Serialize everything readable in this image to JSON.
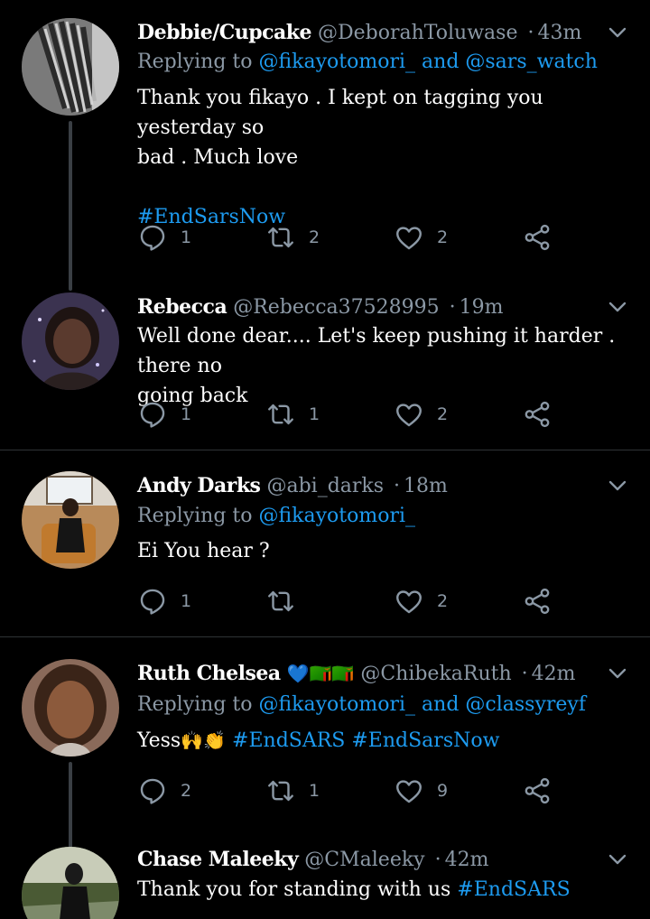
{
  "tweets": [
    {
      "name": "Debbie/Cupcake",
      "handle": "@DeborahToluwase",
      "time": "43m",
      "replying_prefix": "Replying to ",
      "replying_to": "@fikayotomori_ and @sars_watch",
      "text_lines": [
        "Thank you fikayo . I kept on tagging you yesterday so",
        "bad . Much love"
      ],
      "hashtag": "#EndSarsNow",
      "replies": "1",
      "retweets": "2",
      "likes": "2"
    },
    {
      "name": "Rebecca",
      "handle": "@Rebecca37528995",
      "time": "19m",
      "text_lines": [
        "Well done dear.... Let's keep pushing it harder . there no",
        "going back"
      ],
      "replies": "1",
      "retweets": "1",
      "likes": "2"
    },
    {
      "name": "Andy Darks",
      "handle": "@abi_darks",
      "time": "18m",
      "replying_prefix": "Replying to ",
      "replying_to": "@fikayotomori_",
      "text": "Ei You hear ?",
      "replies": "1",
      "retweets": "",
      "likes": "2"
    },
    {
      "name": "Ruth Chelsea",
      "name_emojis": "💙🇿🇲🇿🇲",
      "handle": "@ChibekaRuth",
      "time": "42m",
      "replying_prefix": "Replying to ",
      "replying_to": "@fikayotomori_ and @classyreyf",
      "text_prefix": "Yess",
      "text_emojis": "🙌👏",
      "hashtags": "#EndSARS #EndSarsNow",
      "replies": "2",
      "retweets": "1",
      "likes": "9"
    },
    {
      "name": "Chase Maleeky",
      "handle": "@CMaleeky",
      "time": "42m",
      "text_prefix": "Thank you for standing with us ",
      "hashtag": "#EndSARS"
    }
  ],
  "colors": {
    "background": "#000000",
    "secondary": "#8b98a5",
    "link": "#1d9bf0",
    "divider": "#2f3336"
  },
  "icons": [
    "reply-icon",
    "retweet-icon",
    "like-icon",
    "share-icon",
    "chevron-down-icon"
  ]
}
